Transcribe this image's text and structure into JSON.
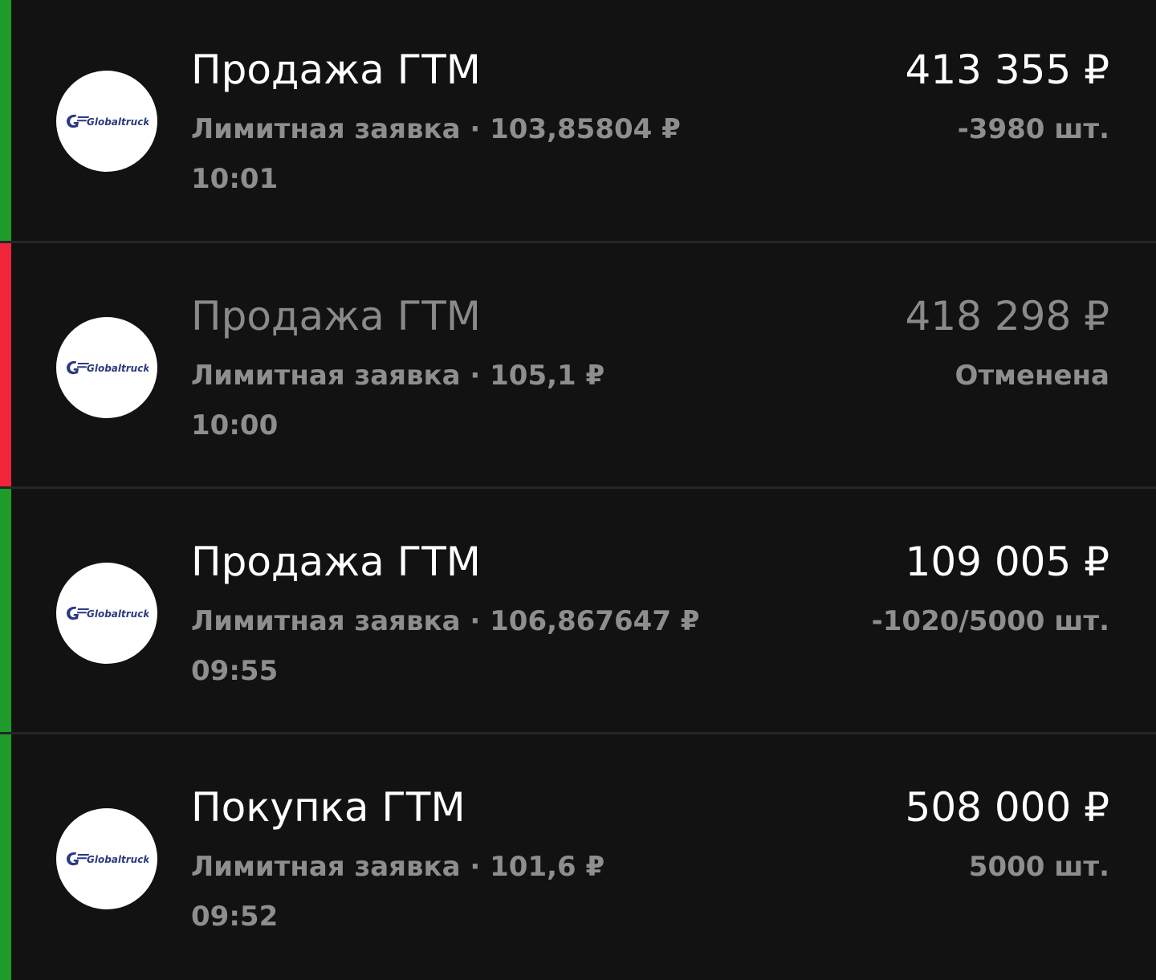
{
  "colors": {
    "background": "#121212",
    "divider": "#262626",
    "primary_text": "#ffffff",
    "muted_text": "#8e8e8e",
    "cancelled_text": "#8a8a8a",
    "executed_bar": "#1e9b2a",
    "cancelled_bar": "#f0243a",
    "logo_brand": "#2b3a82"
  },
  "orders": [
    {
      "title": "Продажа ГТМ",
      "subtitle": "Лимитная заявка · 103,85804 ₽",
      "time": "10:01",
      "amount": "413 355 ₽",
      "quantity": "-3980 шт.",
      "status": "executed",
      "logo_text": "Globaltruck",
      "logo_icon": "globaltruck-logo-icon"
    },
    {
      "title": "Продажа ГТМ",
      "subtitle": "Лимитная заявка · 105,1 ₽",
      "time": "10:00",
      "amount": "418 298 ₽",
      "quantity": "Отменена",
      "status": "cancelled",
      "logo_text": "Globaltruck",
      "logo_icon": "globaltruck-logo-icon"
    },
    {
      "title": "Продажа ГТМ",
      "subtitle": "Лимитная заявка · 106,867647 ₽",
      "time": "09:55",
      "amount": "109 005 ₽",
      "quantity": "-1020/5000 шт.",
      "status": "executed",
      "logo_text": "Globaltruck",
      "logo_icon": "globaltruck-logo-icon"
    },
    {
      "title": "Покупка ГТМ",
      "subtitle": "Лимитная заявка · 101,6 ₽",
      "time": "09:52",
      "amount": "508 000 ₽",
      "quantity": "5000 шт.",
      "status": "executed",
      "logo_text": "Globaltruck",
      "logo_icon": "globaltruck-logo-icon"
    }
  ]
}
